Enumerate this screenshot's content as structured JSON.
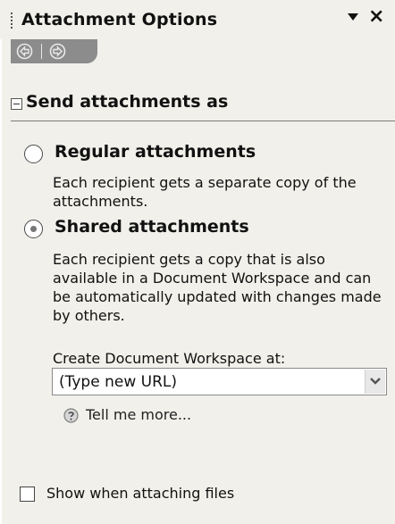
{
  "pane": {
    "title": "Attachment Options",
    "section_title": "Send attachments as"
  },
  "options": {
    "regular": {
      "label": "Regular attachments",
      "description": "Each recipient gets a separate copy of the attachments.",
      "selected": false
    },
    "shared": {
      "label": "Shared attachments",
      "description": "Each recipient gets a copy that is also available in a Document Workspace and can be automatically updated with changes made by others.",
      "selected": true
    }
  },
  "workspace": {
    "label": "Create Document Workspace at:",
    "selected_value": "(Type new URL)"
  },
  "help": {
    "link_text": "Tell me more..."
  },
  "footer": {
    "checkbox_label": "Show when attaching files",
    "checked": false
  },
  "icons": {
    "back": "back-arrow-icon",
    "forward": "forward-arrow-icon",
    "menu": "chevron-down-icon",
    "close": "close-icon",
    "help": "help-icon"
  }
}
